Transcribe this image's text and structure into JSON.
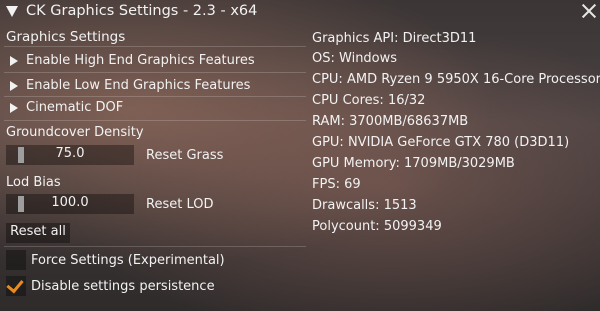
{
  "window": {
    "title": "CK Graphics Settings - 2.3 - x64"
  },
  "settings": {
    "header": "Graphics Settings",
    "groups": [
      {
        "label": "Enable High End Graphics Features"
      },
      {
        "label": "Enable Low End Graphics Features"
      },
      {
        "label": "Cinematic DOF"
      }
    ],
    "groundcover": {
      "label": "Groundcover Density",
      "value": "75.0",
      "reset_label": "Reset Grass"
    },
    "lod": {
      "label": "Lod Bias",
      "value": "100.0",
      "reset_label": "Reset LOD"
    },
    "reset_all_label": "Reset all",
    "force_settings": {
      "label": "Force Settings (Experimental)",
      "checked": false
    },
    "disable_persistence": {
      "label": "Disable settings persistence",
      "checked": true,
      "check_color": "#e88a1e"
    }
  },
  "info": [
    {
      "label": "Graphics API:",
      "value": "Direct3D11"
    },
    {
      "label": "OS:",
      "value": "Windows"
    },
    {
      "label": "CPU:",
      "value": "AMD Ryzen 9 5950X 16-Core Processor"
    },
    {
      "label": "CPU Cores:",
      "value": "16/32"
    },
    {
      "label": "RAM:",
      "value": "3700MB/68637MB"
    },
    {
      "label": "GPU:",
      "value": "NVIDIA GeForce GTX 780 (D3D11)"
    },
    {
      "label": "GPU Memory:",
      "value": "1709MB/3029MB"
    },
    {
      "label": "FPS:",
      "value": "69"
    },
    {
      "label": "Drawcalls:",
      "value": "1513"
    },
    {
      "label": "Polycount:",
      "value": "5099349"
    }
  ],
  "icons": [
    "collapse-arrow-icon",
    "close-icon",
    "expand-arrow-icon",
    "checkmark-icon"
  ]
}
